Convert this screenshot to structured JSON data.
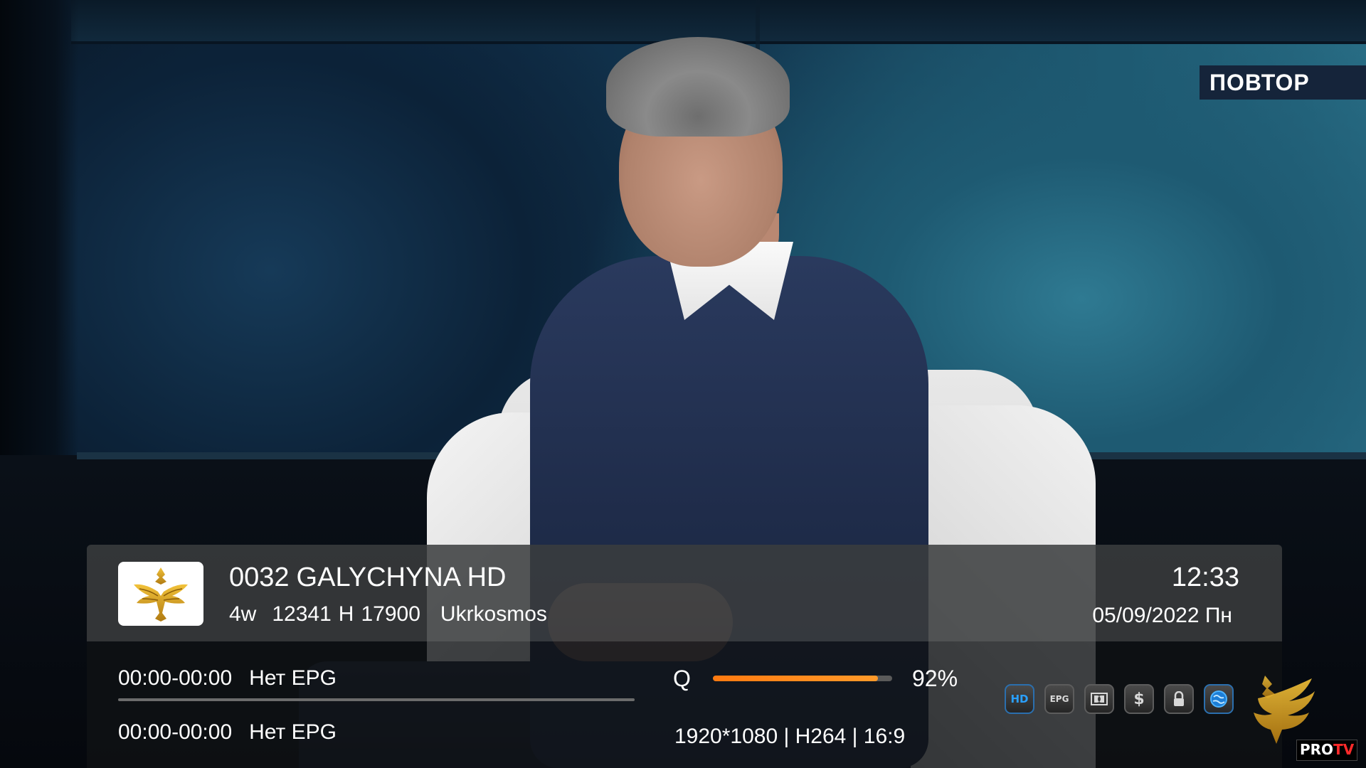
{
  "overlay": {
    "repeat_label": "ПОВТОР"
  },
  "channel": {
    "number": "0032",
    "name": "GALYCHYNA HD",
    "satellite": "4w",
    "frequency": "12341",
    "polarization": "H",
    "symbol_rate": "17900",
    "provider": "Ukrkosmos",
    "logo_icon": "galychyna-eagle-icon"
  },
  "clock": {
    "time": "12:33",
    "date": "05/09/2022 Пн"
  },
  "epg": [
    {
      "time": "00:00-00:00",
      "title": "Нет EPG"
    },
    {
      "time": "00:00-00:00",
      "title": "Нет EPG"
    }
  ],
  "signal": {
    "label": "Q",
    "quality_percent": 92,
    "quality_text": "92%",
    "bar_color": "#ff7a10"
  },
  "video_info": "1920*1080 | H264 | 16:9",
  "status_icons": [
    {
      "name": "hd-icon",
      "label": "HD",
      "active": true
    },
    {
      "name": "epg-icon",
      "label": "EPG",
      "active": false
    },
    {
      "name": "dolby-icon",
      "label": "DD",
      "active": false
    },
    {
      "name": "scrambled-dollar-icon",
      "label": "$",
      "active": false
    },
    {
      "name": "lock-icon",
      "label": "🔒",
      "active": false
    },
    {
      "name": "satellite-globe-icon",
      "label": "◉",
      "active": true
    }
  ],
  "watermark": {
    "pro": "PRO",
    "tv": "TV"
  }
}
